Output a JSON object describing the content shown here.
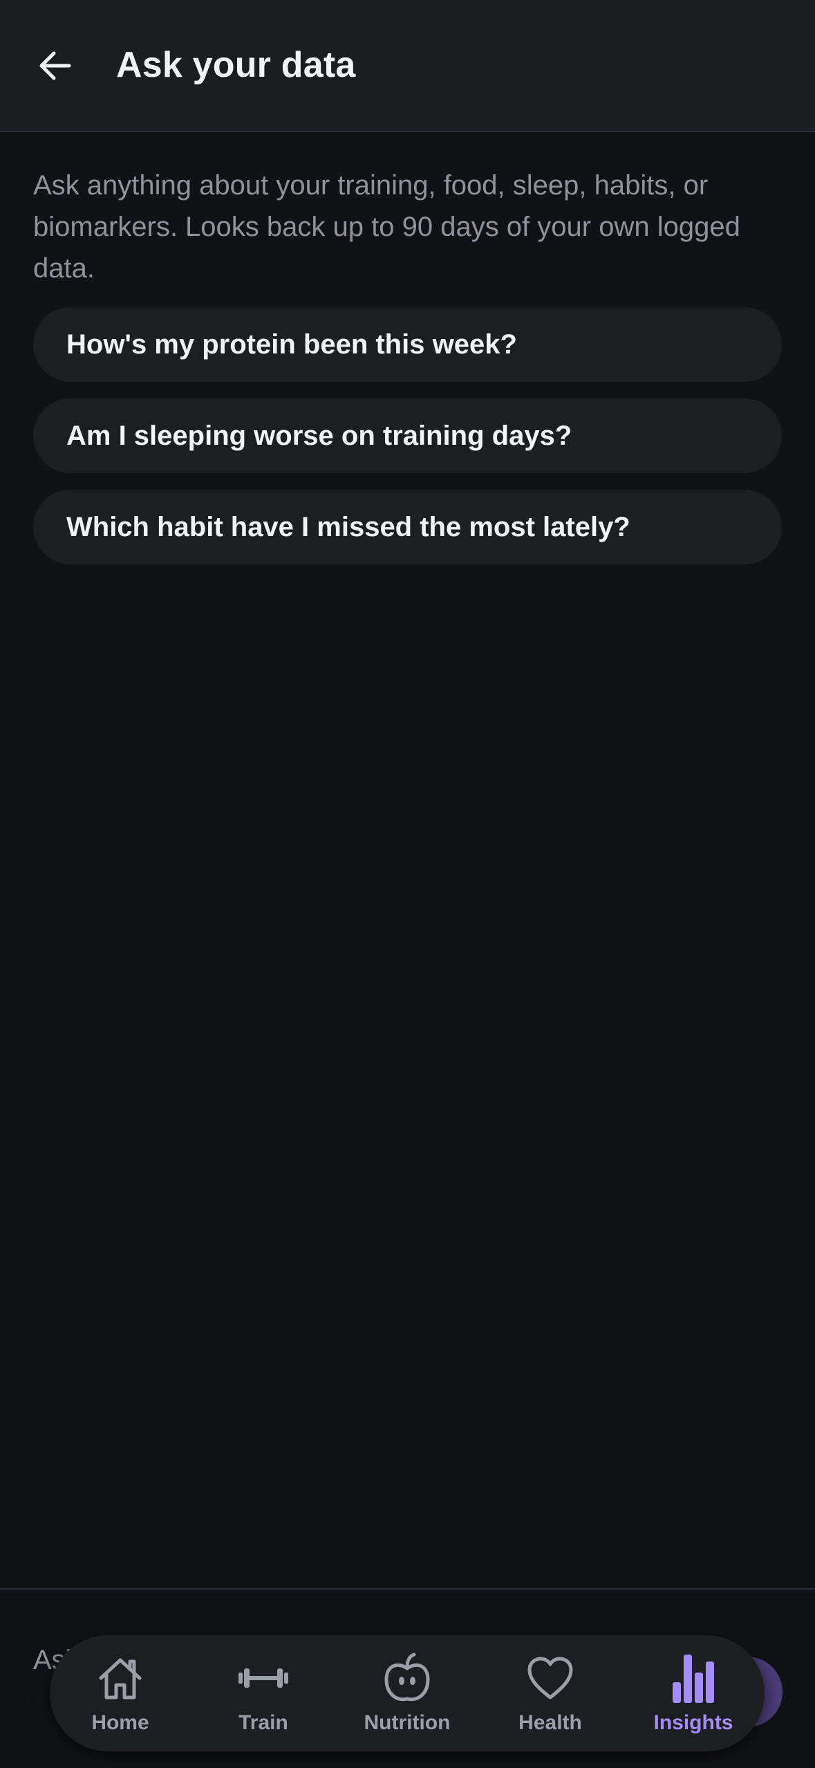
{
  "header": {
    "title": "Ask your data",
    "back_icon": "arrow-left-icon"
  },
  "intro": "Ask anything about your training, food, sleep, habits, or biomarkers. Looks back up to 90 days of your own logged data.",
  "suggestions": [
    "How's my protein been this week?",
    "Am I sleeping worse on training days?",
    "Which habit have I missed the most lately?"
  ],
  "composer": {
    "placeholder": "Ask"
  },
  "tabs": [
    {
      "label": "Home",
      "icon": "home-icon"
    },
    {
      "label": "Train",
      "icon": "dumbbell-icon"
    },
    {
      "label": "Nutrition",
      "icon": "apple-icon"
    },
    {
      "label": "Health",
      "icon": "heart-icon"
    },
    {
      "label": "Insights",
      "icon": "bar-chart-icon",
      "active": true
    }
  ],
  "colors": {
    "background": "#111215",
    "surface": "#1c1e22",
    "accent": "#a58cf7",
    "muted_text": "#8e939c"
  }
}
